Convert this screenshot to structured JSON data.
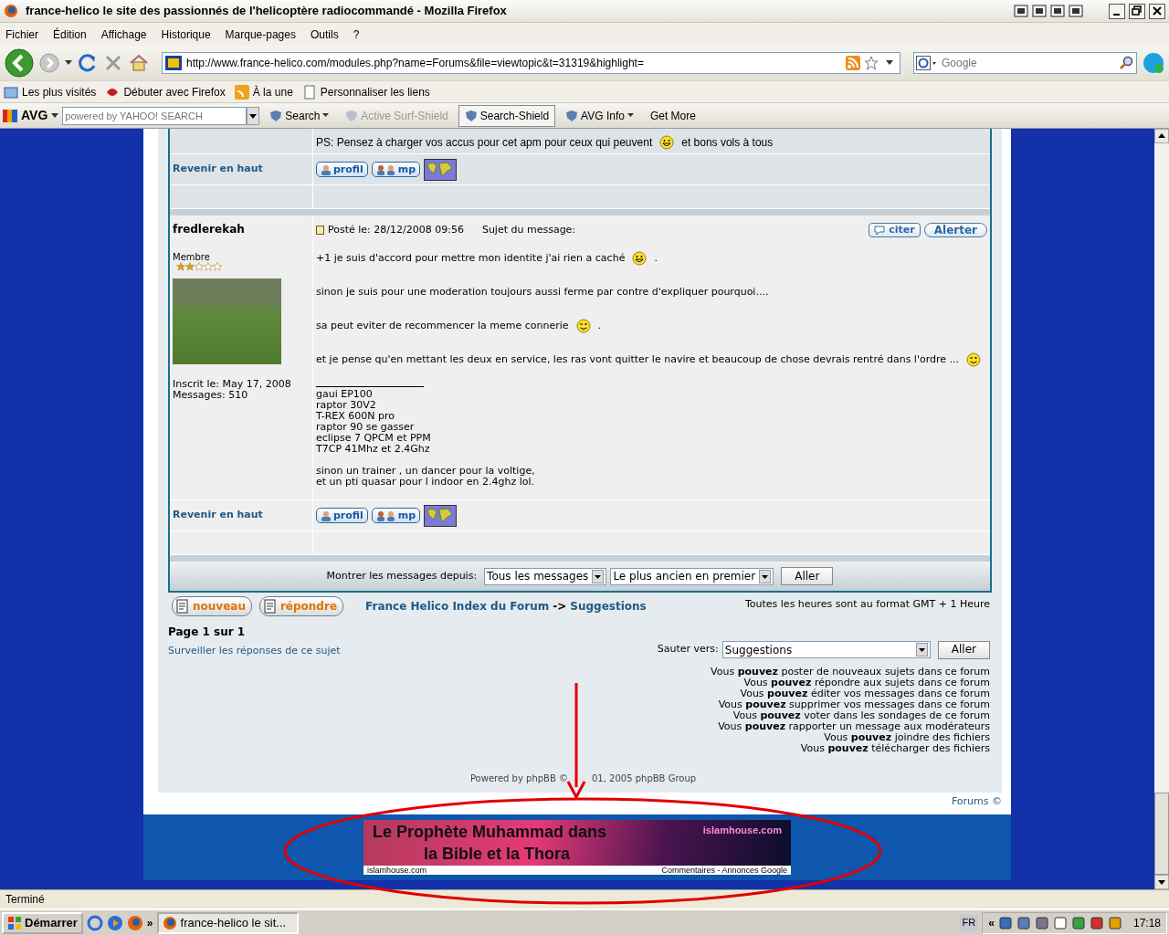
{
  "window": {
    "title": "france-helico le site des passionnés de l'helicoptère radiocommandé - Mozilla Firefox"
  },
  "menu": [
    "Fichier",
    "Édition",
    "Affichage",
    "Historique",
    "Marque-pages",
    "Outils",
    "?"
  ],
  "address_bar": {
    "value": "http://www.france-helico.com/modules.php?name=Forums&file=viewtopic&t=31319&highlight="
  },
  "search_box": {
    "placeholder": "Google"
  },
  "bookmarks": [
    {
      "label": "Les plus visités"
    },
    {
      "label": "Débuter avec Firefox"
    },
    {
      "label": "À la une"
    },
    {
      "label": "Personnaliser les liens"
    }
  ],
  "avg_toolbar": {
    "logo": "AVG",
    "search_placeholder": "powered by YAHOO! SEARCH",
    "items": [
      {
        "label": "Search",
        "dropdown": true,
        "disabled": false,
        "selected": false
      },
      {
        "label": "Active Surf-Shield",
        "dropdown": false,
        "disabled": true,
        "selected": false
      },
      {
        "label": "Search-Shield",
        "dropdown": false,
        "disabled": false,
        "selected": true
      },
      {
        "label": "AVG Info",
        "dropdown": true,
        "disabled": false,
        "selected": false
      },
      {
        "label": "Get More",
        "dropdown": false,
        "disabled": false,
        "selected": false
      }
    ]
  },
  "posts": [
    {
      "paragraphs": [
        [
          {
            "kind": "text",
            "text": "PS: Pensez à charger vos accus pour cet apm pour ceux qui peuvent"
          },
          {
            "kind": "grin"
          },
          {
            "kind": "text",
            "text": "et bons vols à tous"
          }
        ]
      ],
      "back_to_top": "Revenir en haut",
      "profile_buttons": [
        "profil",
        "mp"
      ]
    },
    {
      "author": "fredlerekah",
      "rank": "Membre",
      "stars": 2,
      "joined": "Inscrit le: May 17, 2008",
      "messages": "Messages: 510",
      "posted": "Posté le: 28/12/2008 09:56",
      "subject_label": "Sujet du message:",
      "actions": [
        "citer",
        "Alerter"
      ],
      "paragraphs": [
        [
          {
            "kind": "text",
            "text": "+1 je suis d'accord pour mettre mon identite j'ai rien a caché"
          },
          {
            "kind": "grin"
          },
          {
            "kind": "text",
            "text": "."
          }
        ],
        [
          {
            "kind": "text",
            "text": "sinon je suis pour une moderation toujours aussi ferme par contre d'expliquer pourquoi...."
          }
        ],
        [
          {
            "kind": "text",
            "text": "sa peut eviter de recommencer la meme connerie"
          },
          {
            "kind": "wink"
          },
          {
            "kind": "text",
            "text": "."
          }
        ],
        [
          {
            "kind": "text",
            "text": "et je pense qu'en mettant les deux en service, les ras vont quitter le navire et beaucoup de chose devrais rentré dans l'ordre ..."
          },
          {
            "kind": "wink"
          }
        ]
      ],
      "signature": [
        "gaui EP100",
        "raptor 30V2",
        "T-REX 600N pro",
        "raptor 90 se gasser",
        "eclipse 7 QPCM et PPM",
        "T7CP 41Mhz et 2.4Ghz"
      ],
      "signature_note": [
        "sinon un trainer , un dancer pour la voltige,",
        "et un pti quasar pour l indoor en 2.4ghz lol."
      ],
      "back_to_top": "Revenir en haut",
      "profile_buttons": [
        "profil",
        "mp"
      ]
    }
  ],
  "display_options": {
    "label": "Montrer les messages depuis:",
    "since": "Tous les messages",
    "order": "Le plus ancien en premier",
    "button": "Aller"
  },
  "actions": [
    {
      "label": "nouveau"
    },
    {
      "label": "répondre"
    }
  ],
  "breadcrumb": {
    "forum_index": "France Helico Index du Forum",
    "separator": "->",
    "current": "Suggestions"
  },
  "timezone": "Toutes les heures sont au format GMT + 1 Heure",
  "pagination": "Page 1 sur 1",
  "watch_link": "Surveiller les réponses de ce sujet",
  "jump": {
    "label": "Sauter vers:",
    "value": "Suggestions",
    "button": "Aller"
  },
  "permissions": [
    "Vous **pouvez** poster de nouveaux sujets dans ce forum",
    "Vous **pouvez** répondre aux sujets dans ce forum",
    "Vous **pouvez** éditer vos messages dans ce forum",
    "Vous **pouvez** supprimer vos messages dans ce forum",
    "Vous **pouvez** voter dans les sondages de ce forum",
    "Vous **pouvez** rapporter un message aux modérateurs",
    "Vous **pouvez** joindre des fichiers",
    "Vous **pouvez** télécharger des fichiers"
  ],
  "powered_by": [
    "Powered by phpBB ©",
    "01, 2005 phpBB Group"
  ],
  "forums_link": "Forums ©",
  "ad": {
    "headline": [
      "Le Prophète Muhammad dans",
      "la Bible et la Thora"
    ],
    "site": "islamhouse.com",
    "footer_left": "islamhouse.com",
    "footer_right": "Commentaires - Annonces Google"
  },
  "status_bar": "Terminé",
  "taskbar": {
    "start": "Démarrer",
    "overflow": "»",
    "tasks": [
      {
        "label": "france-helico le sit...",
        "selected": true
      }
    ],
    "language": "FR",
    "tray_toggle": "«",
    "clock": "17:18"
  }
}
